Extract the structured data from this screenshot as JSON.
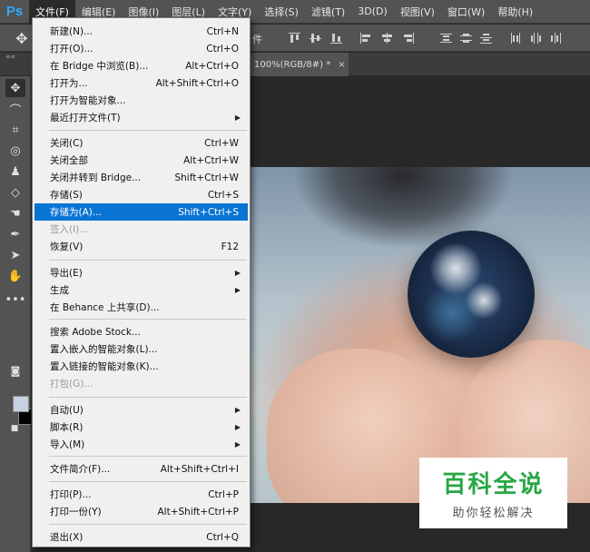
{
  "app": {
    "logo": "Ps"
  },
  "menubar": {
    "items": [
      {
        "label": "文件(F)"
      },
      {
        "label": "编辑(E)"
      },
      {
        "label": "图像(I)"
      },
      {
        "label": "图层(L)"
      },
      {
        "label": "文字(Y)"
      },
      {
        "label": "选择(S)"
      },
      {
        "label": "滤镜(T)"
      },
      {
        "label": "3D(D)"
      },
      {
        "label": "视图(V)"
      },
      {
        "label": "窗口(W)"
      },
      {
        "label": "帮助(H)"
      }
    ]
  },
  "options_bar": {
    "label_fragment": "件"
  },
  "tab": {
    "title": "100%(RGB/8#) *",
    "close": "×"
  },
  "panel_collapse": "««",
  "file_menu": {
    "items": [
      {
        "label": "新建(N)...",
        "shortcut": "Ctrl+N"
      },
      {
        "label": "打开(O)...",
        "shortcut": "Ctrl+O"
      },
      {
        "label": "在 Bridge 中浏览(B)...",
        "shortcut": "Alt+Ctrl+O"
      },
      {
        "label": "打开为...",
        "shortcut": "Alt+Shift+Ctrl+O"
      },
      {
        "label": "打开为智能对象...",
        "shortcut": ""
      },
      {
        "label": "最近打开文件(T)",
        "shortcut": "",
        "submenu": true
      },
      {
        "label": "关闭(C)",
        "shortcut": "Ctrl+W"
      },
      {
        "label": "关闭全部",
        "shortcut": "Alt+Ctrl+W"
      },
      {
        "label": "关闭并转到 Bridge...",
        "shortcut": "Shift+Ctrl+W"
      },
      {
        "label": "存储(S)",
        "shortcut": "Ctrl+S"
      },
      {
        "label": "存储为(A)...",
        "shortcut": "Shift+Ctrl+S",
        "highlighted": true
      },
      {
        "label": "签入(I)...",
        "shortcut": "",
        "disabled": true
      },
      {
        "label": "恢复(V)",
        "shortcut": "F12"
      },
      {
        "label": "导出(E)",
        "shortcut": "",
        "submenu": true
      },
      {
        "label": "生成",
        "shortcut": "",
        "submenu": true
      },
      {
        "label": "在 Behance 上共享(D)...",
        "shortcut": ""
      },
      {
        "label": "搜索 Adobe Stock...",
        "shortcut": ""
      },
      {
        "label": "置入嵌入的智能对象(L)...",
        "shortcut": ""
      },
      {
        "label": "置入链接的智能对象(K)...",
        "shortcut": ""
      },
      {
        "label": "打包(G)...",
        "shortcut": "",
        "disabled": true
      },
      {
        "label": "自动(U)",
        "shortcut": "",
        "submenu": true
      },
      {
        "label": "脚本(R)",
        "shortcut": "",
        "submenu": true
      },
      {
        "label": "导入(M)",
        "shortcut": "",
        "submenu": true
      },
      {
        "label": "文件简介(F)...",
        "shortcut": "Alt+Shift+Ctrl+I"
      },
      {
        "label": "打印(P)...",
        "shortcut": "Ctrl+P"
      },
      {
        "label": "打印一份(Y)",
        "shortcut": "Alt+Shift+Ctrl+P"
      },
      {
        "label": "退出(X)",
        "shortcut": "Ctrl+Q"
      }
    ],
    "submenu_arrow": "▶"
  },
  "watermark": {
    "title": "百科全说",
    "subtitle": "助你轻松解决"
  },
  "colors": {
    "highlight": "#0a74d4",
    "logo": "#31a8ff",
    "foreground_swatch": "#c8d0e4",
    "background_swatch": "#000000",
    "watermark_green": "#27a745"
  }
}
